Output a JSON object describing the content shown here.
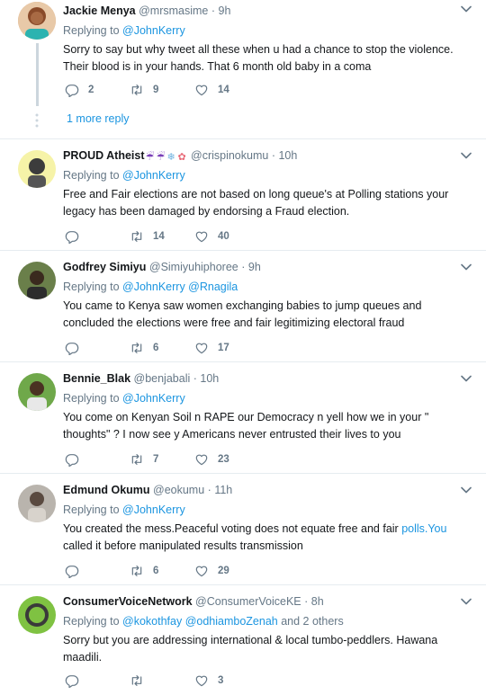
{
  "tweets": [
    {
      "name": "Jackie Menya",
      "handle": "@mrsmasime",
      "time": "9h",
      "replying_label": "Replying to",
      "mentions": "@JohnKerry",
      "text": "Sorry to say but why tweet all these when u had a chance to stop the violence. Their blood is in your hands. That 6 month old baby in a coma",
      "reply_count": "2",
      "retweet_count": "9",
      "like_count": "14",
      "more_reply": "1 more reply"
    },
    {
      "name": "PROUD Atheist",
      "handle": "@crispinokumu",
      "time": "10h",
      "replying_label": "Replying to",
      "mentions": "@JohnKerry",
      "text": "Free and Fair elections are not based on long queue's at Polling stations your legacy has been damaged by endorsing  a Fraud election.",
      "reply_count": "",
      "retweet_count": "14",
      "like_count": "40"
    },
    {
      "name": "Godfrey Simiyu",
      "handle": "@Simiyuhiphoree",
      "time": "9h",
      "replying_label": "Replying to",
      "mentions": "@JohnKerry @Rnagila",
      "text": "You came to Kenya saw women exchanging babies to jump queues and concluded the elections were free and fair legitimizing electoral fraud",
      "reply_count": "",
      "retweet_count": "6",
      "like_count": "17"
    },
    {
      "name": "Bennie_Blak",
      "handle": "@benjabali",
      "time": "10h",
      "replying_label": "Replying to",
      "mentions": "@JohnKerry",
      "text": "You come on Kenyan Soil n RAPE our Democracy n yell how we in your \" thoughts\" ?  I now see y Americans never entrusted their lives to you",
      "reply_count": "",
      "retweet_count": "7",
      "like_count": "23"
    },
    {
      "name": "Edmund Okumu",
      "handle": "@eokumu",
      "time": "11h",
      "replying_label": "Replying to",
      "mentions": "@JohnKerry",
      "text": "You created the mess.Peaceful voting does not equate free and fair ",
      "text_link": "polls.You",
      "text_after": "called it before manipulated results transmission",
      "reply_count": "",
      "retweet_count": "6",
      "like_count": "29"
    },
    {
      "name": "ConsumerVoiceNetwork",
      "handle": "@ConsumerVoiceKE",
      "time": "8h",
      "replying_label": "Replying to",
      "mentions": "@kokothfay @odhiamboZenah",
      "mentions_suffix": "and 2 others",
      "text": "Sorry but you are addressing international & local tumbo-peddlers. Hawana maadili.",
      "reply_count": "",
      "retweet_count": "",
      "like_count": "3"
    }
  ],
  "separator": "·",
  "colors": {
    "link": "#1b95e0",
    "muted": "#657786",
    "border": "#e6ecf0",
    "thread_line": "#ccd6dd"
  },
  "icons": [
    "reply-icon",
    "retweet-icon",
    "like-icon",
    "chevron-down-icon"
  ]
}
